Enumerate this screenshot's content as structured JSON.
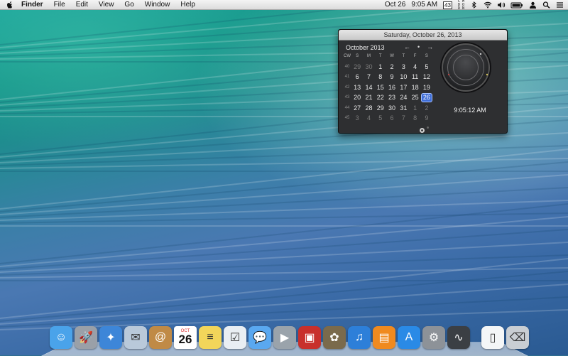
{
  "menubar": {
    "app_name": "Finder",
    "menus": [
      "File",
      "Edit",
      "View",
      "Go",
      "Window",
      "Help"
    ],
    "date": "Oct 26",
    "time": "9:05 AM",
    "cal_badge": "43",
    "cmd_stack": [
      "C M",
      "D O",
      "D N"
    ],
    "icons": [
      "bluetooth-icon",
      "wifi-icon",
      "volume-icon",
      "battery-icon",
      "user-icon",
      "search-icon",
      "list-icon"
    ]
  },
  "calendar_widget": {
    "title": "Saturday, October 26, 2013",
    "month": "October 2013",
    "nav": [
      "←",
      "•",
      "→"
    ],
    "week_header": [
      "CW",
      "S",
      "M",
      "T",
      "W",
      "T",
      "F",
      "S"
    ],
    "weeks": [
      {
        "cw": "40",
        "days": [
          "29",
          "30",
          "1",
          "2",
          "3",
          "4",
          "5"
        ],
        "dim": [
          0,
          1
        ]
      },
      {
        "cw": "41",
        "days": [
          "6",
          "7",
          "8",
          "9",
          "10",
          "11",
          "12"
        ],
        "dim": []
      },
      {
        "cw": "42",
        "days": [
          "13",
          "14",
          "15",
          "16",
          "17",
          "18",
          "19"
        ],
        "dim": []
      },
      {
        "cw": "43",
        "days": [
          "20",
          "21",
          "22",
          "23",
          "24",
          "25",
          "26"
        ],
        "dim": []
      },
      {
        "cw": "44",
        "days": [
          "27",
          "28",
          "29",
          "30",
          "31",
          "1",
          "2"
        ],
        "dim": [
          5,
          6
        ]
      },
      {
        "cw": "45",
        "days": [
          "3",
          "4",
          "5",
          "6",
          "7",
          "8",
          "9"
        ],
        "dim": [
          0,
          1,
          2,
          3,
          4,
          5,
          6
        ]
      }
    ],
    "today_index": [
      3,
      6
    ],
    "clock_time": "9:05:12 AM"
  },
  "dock": {
    "today_day": "26",
    "cal_month": "OCT",
    "apps": [
      {
        "name": "finder",
        "icon": "finder-icon",
        "color": "#4aa3ea"
      },
      {
        "name": "launchpad",
        "icon": "rocket-icon",
        "color": "#9aa0a8"
      },
      {
        "name": "safari",
        "icon": "compass-icon",
        "color": "#3d86d8"
      },
      {
        "name": "mail",
        "icon": "mail-icon",
        "color": "#b9c9da"
      },
      {
        "name": "contacts",
        "icon": "contacts-icon",
        "color": "#c08a46"
      },
      {
        "name": "calendar",
        "icon": "calendar-icon",
        "color": "#ffffff"
      },
      {
        "name": "notes",
        "icon": "notes-icon",
        "color": "#f2d55a"
      },
      {
        "name": "reminders",
        "icon": "reminders-icon",
        "color": "#e9eef3"
      },
      {
        "name": "messages",
        "icon": "messages-icon",
        "color": "#5aa8f0"
      },
      {
        "name": "facetime",
        "icon": "camera-icon",
        "color": "#9aa3ab"
      },
      {
        "name": "photo-booth",
        "icon": "photo-booth-icon",
        "color": "#c8302c"
      },
      {
        "name": "iphoto",
        "icon": "photos-icon",
        "color": "#7a6a4c"
      },
      {
        "name": "itunes",
        "icon": "music-icon",
        "color": "#2d7fd9"
      },
      {
        "name": "ibooks",
        "icon": "book-icon",
        "color": "#f08a1f"
      },
      {
        "name": "app-store",
        "icon": "app-store-icon",
        "color": "#2a8ae6"
      },
      {
        "name": "system-preferences",
        "icon": "gear-icon",
        "color": "#8d9298"
      },
      {
        "name": "activity-monitor",
        "icon": "monitor-icon",
        "color": "#3b3f44"
      }
    ],
    "right_items": [
      {
        "name": "documents-folder",
        "icon": "document-icon",
        "color": "#f4f6f7"
      },
      {
        "name": "trash",
        "icon": "trash-icon",
        "color": "#c9ced3"
      }
    ]
  },
  "colors": {
    "menubar": "#e8e8e8",
    "widget_bg": "#2e2f31",
    "today_highlight": "#3f6ed8"
  }
}
